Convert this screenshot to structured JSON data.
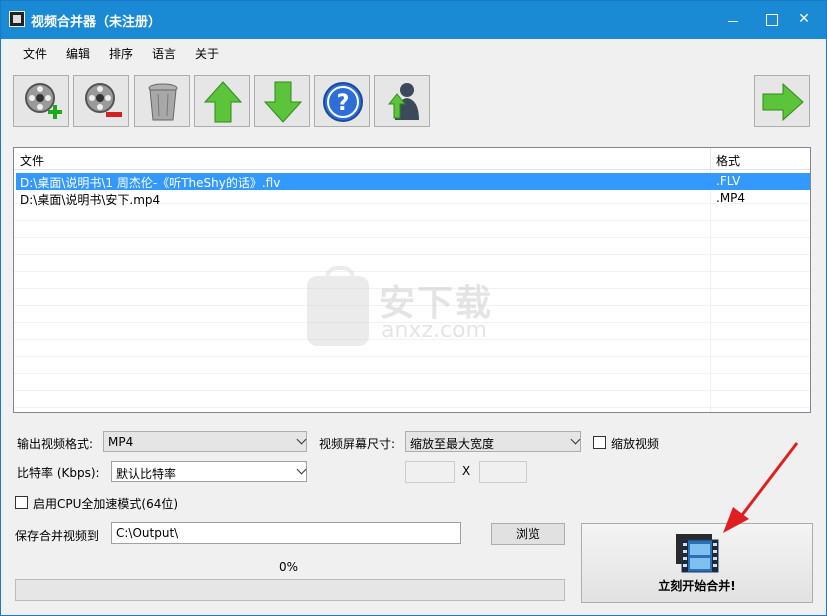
{
  "window": {
    "title": "视频合并器（未注册）"
  },
  "menu": [
    "文件",
    "编辑",
    "排序",
    "语言",
    "关于"
  ],
  "toolbar": {
    "buttons": [
      "add-video-icon",
      "remove-video-icon",
      "trash-icon",
      "move-up-icon",
      "move-down-icon",
      "help-icon",
      "upgrade-icon",
      "next-icon"
    ]
  },
  "file_list": {
    "columns": [
      "文件",
      "格式"
    ],
    "rows": [
      {
        "file": "D:\\桌面\\说明书\\1 周杰伦-《听TheShy的话》.flv",
        "format": ".FLV",
        "selected": true
      },
      {
        "file": "D:\\桌面\\说明书\\安下.mp4",
        "format": ".MP4",
        "selected": false
      }
    ]
  },
  "watermark": {
    "text": "安下载",
    "sub": "anxz.com"
  },
  "settings": {
    "output_format_label": "输出视频格式:",
    "output_format_value": "MP4",
    "screen_size_label": "视频屏幕尺寸:",
    "screen_size_value": "缩放至最大宽度",
    "scale_video_label": "缩放视频",
    "bitrate_label": "比特率 (Kbps):",
    "bitrate_value": "默认比特率",
    "x_label": "X",
    "cpu_accel_label": "启用CPU全加速模式(64位)",
    "save_label": "保存合并视频到",
    "save_path": "C:\\Output\\",
    "browse_label": "浏览",
    "progress_text": "0%",
    "progress": 0
  },
  "start_button": {
    "label": "立刻开始合并!"
  },
  "colors": {
    "titlebar": "#1a8ad4",
    "selection": "#3399ff",
    "annotation": "#e02020"
  }
}
